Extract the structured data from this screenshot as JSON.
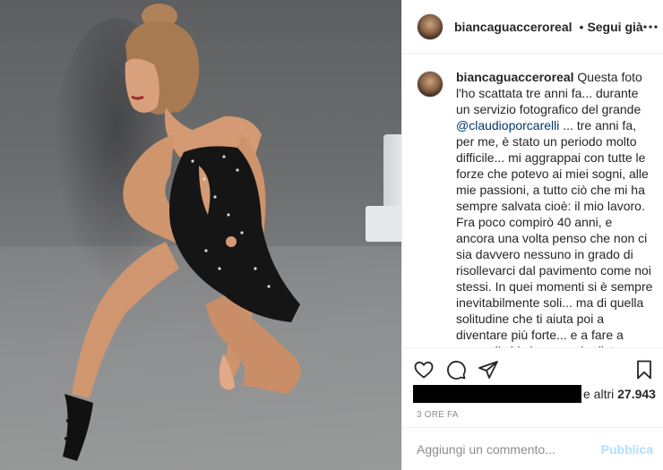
{
  "header": {
    "username": "biancaguaccero",
    "username_suffix": "real",
    "verified": true,
    "separator": "•",
    "follow_label": "Segui già",
    "more_icon": "more-horizontal-icon"
  },
  "caption": {
    "username": "biancaguaccero",
    "username_suffix": "real",
    "text_before_mention": " Questa foto l'ho scattata tre anni fa... durante un servizio fotografico del grande ",
    "mention": "@claudioporcarelli",
    "text_after_mention": " ... tre anni fa, per me, è stato un periodo molto difficile... mi aggrappai con tutte le forze che potevo ai miei sogni, alle mie passioni, a tutto ciò che mi ha sempre salvata cioè: il mio lavoro. Fra poco compirò 40 anni, e ancora una volta penso che non ci sia davvero nessuno in grado di risollevarci dal pavimento come noi stessi. In quei momenti si è sempre inevitabilmente soli... ma di quella solitudine che ti aiuta poi a diventare più forte... e a fare a meno di chi si nasconde dietro belle parole per poi svanire nell'indifferenza... spesso le persone non ci aiutano perché"
  },
  "actions": {
    "like_icon": "heart-icon",
    "comment_icon": "comment-icon",
    "share_icon": "share-icon",
    "save_icon": "bookmark-icon"
  },
  "likes": {
    "prefix": "e altri ",
    "count": "27.943"
  },
  "timestamp": "3 ore fa",
  "comment_box": {
    "placeholder": "Aggiungi un commento...",
    "publish_label": "Pubblica"
  },
  "colors": {
    "text": "#262626",
    "muted": "#8e8e8e",
    "link": "#00376b",
    "publish_disabled": "#b2dffc",
    "verified": "#3897f0",
    "border": "#efefef"
  }
}
